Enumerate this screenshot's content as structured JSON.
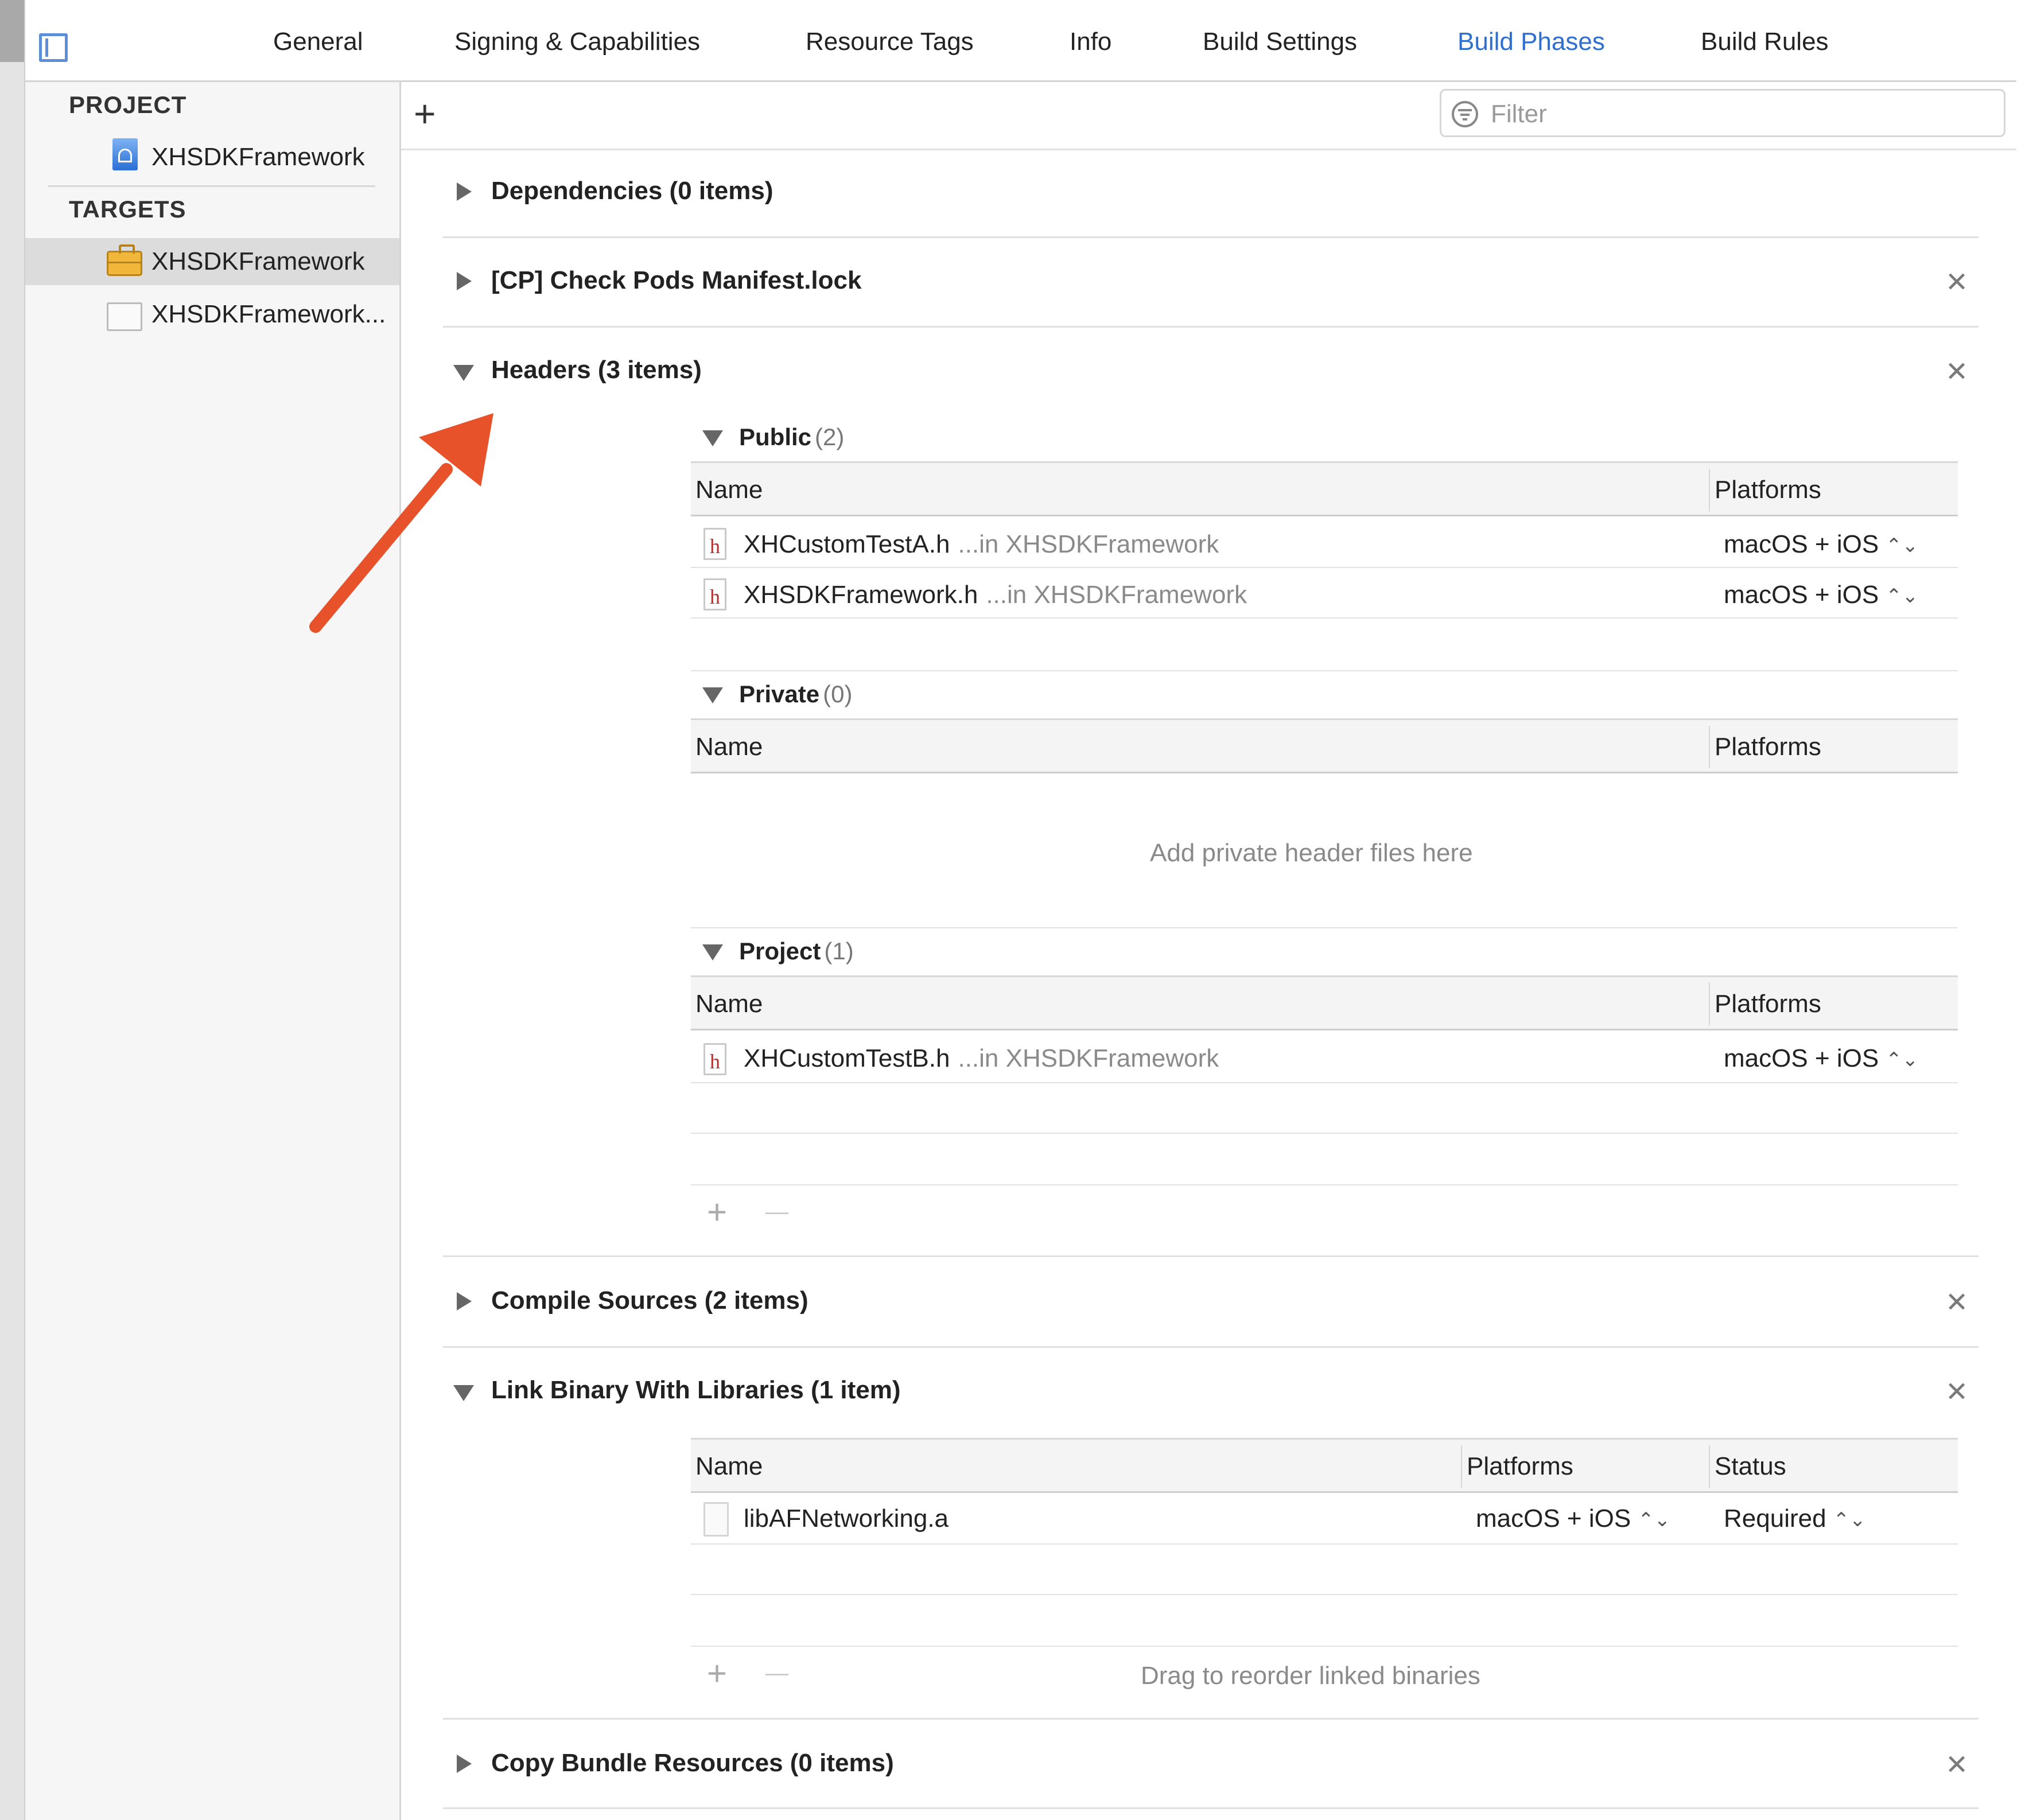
{
  "tabs": [
    {
      "label": "General"
    },
    {
      "label": "Signing & Capabilities"
    },
    {
      "label": "Resource Tags"
    },
    {
      "label": "Info"
    },
    {
      "label": "Build Settings"
    },
    {
      "label": "Build Phases",
      "active": true
    },
    {
      "label": "Build Rules"
    }
  ],
  "sidebar": {
    "project_heading": "PROJECT",
    "project_item": "XHSDKFramework",
    "targets_heading": "TARGETS",
    "targets": [
      {
        "label": "XHSDKFramework",
        "icon": "briefcase-icon",
        "selected": true
      },
      {
        "label": "XHSDKFramework...",
        "icon": "bundle-icon",
        "selected": false
      }
    ]
  },
  "toolbar": {
    "add_label": "+",
    "filter_placeholder": "Filter"
  },
  "phases": {
    "dependencies": "Dependencies (0 items)",
    "check_pods": "[CP] Check Pods Manifest.lock",
    "headers": "Headers (3 items)",
    "compile": "Compile Sources (2 items)",
    "link": "Link Binary With Libraries (1 item)",
    "copy": "Copy Bundle Resources (0 items)"
  },
  "headers": {
    "public": {
      "label": "Public",
      "count": "(2)"
    },
    "private": {
      "label": "Private",
      "count": "(0)"
    },
    "project": {
      "label": "Project",
      "count": "(1)"
    },
    "col_name": "Name",
    "col_platforms": "Platforms",
    "public_rows": [
      {
        "name": "XHCustomTestA.h",
        "location": "...in XHSDKFramework",
        "platforms": "macOS + iOS"
      },
      {
        "name": "XHSDKFramework.h",
        "location": "...in XHSDKFramework",
        "platforms": "macOS + iOS"
      }
    ],
    "private_placeholder": "Add private header files here",
    "project_rows": [
      {
        "name": "XHCustomTestB.h",
        "location": "...in XHSDKFramework",
        "platforms": "macOS + iOS"
      }
    ]
  },
  "link": {
    "col_name": "Name",
    "col_platforms": "Platforms",
    "col_status": "Status",
    "rows": [
      {
        "name": "libAFNetworking.a",
        "platforms": "macOS + iOS",
        "status": "Required"
      }
    ],
    "footer_hint": "Drag to reorder linked binaries"
  },
  "controls": {
    "close_glyph": "✕",
    "plus_glyph": "+",
    "minus_glyph": "—",
    "stepper_glyph": "⌃⌄",
    "hfile_glyph": "h"
  },
  "colors": {
    "accent": "#2f6fd0",
    "arrow": "#e8522a"
  }
}
